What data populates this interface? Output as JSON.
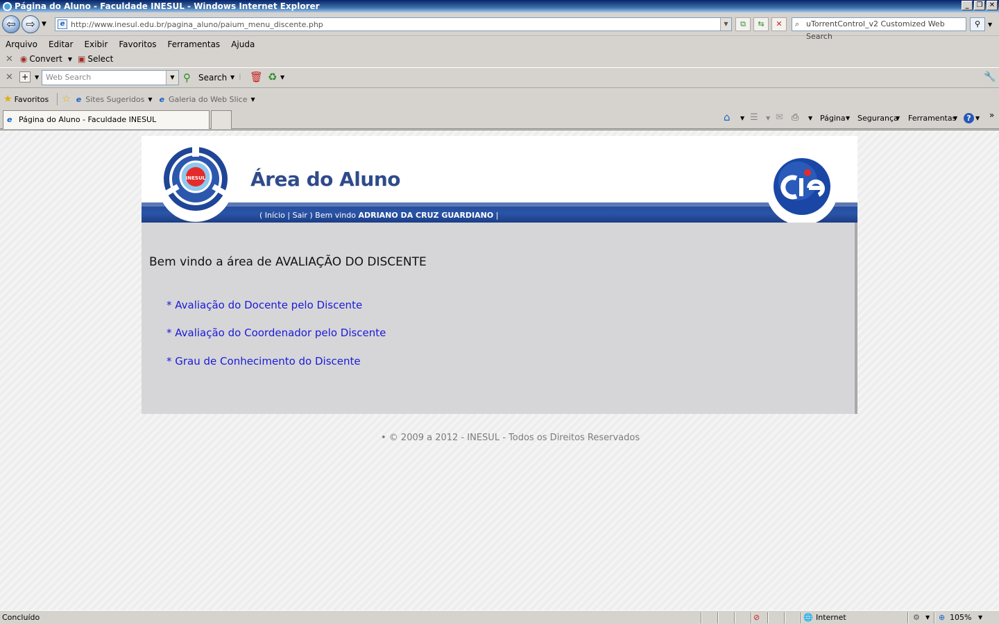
{
  "window": {
    "title": "Página do Aluno - Faculdade INESUL - Windows Internet Explorer",
    "url": "http://www.inesul.edu.br/pagina_aluno/paium_menu_discente.php",
    "search_placeholder": "uTorrentControl_v2 Customized Web Search"
  },
  "menubar": [
    "Arquivo",
    "Editar",
    "Exibir",
    "Favoritos",
    "Ferramentas",
    "Ajuda"
  ],
  "toolbar": {
    "convert_label": "Convert",
    "select_label": "Select",
    "web_search_placeholder": "Web Search",
    "search_label": "Search"
  },
  "favorites": {
    "favorites_label": "Favoritos",
    "suggested_sites": "Sites Sugeridos",
    "web_slice_gallery": "Galeria do Web Slice"
  },
  "tabs": [
    {
      "label": "Página do Aluno - Faculdade INESUL"
    }
  ],
  "command_bar": {
    "page": "Página",
    "security": "Segurança",
    "tools": "Ferramentas"
  },
  "page": {
    "header_title": "Área do Aluno",
    "logo_text": "INESUL",
    "user_nav": {
      "prefix": "( Início | Sair ) Bem vindo ",
      "user_name": "ADRIANO DA CRUZ GUARDIANO",
      "suffix": " |"
    },
    "welcome": "Bem vindo a área de AVALIAÇÃO DO DISCENTE",
    "links": [
      "* Avaliação do Docente pelo Discente",
      "* Avaliação do Coordenador pelo Discente",
      "* Grau de Conhecimento do Discente"
    ],
    "footer": "• © 2009 a 2012 - INESUL - Todos os Direitos Reservados"
  },
  "statusbar": {
    "status": "Concluído",
    "zone": "Internet",
    "zoom": "105%"
  },
  "colors": {
    "brand_blue": "#2f4b8a",
    "link_blue": "#1a1ad8",
    "panel_gray": "#d6d6d9"
  }
}
